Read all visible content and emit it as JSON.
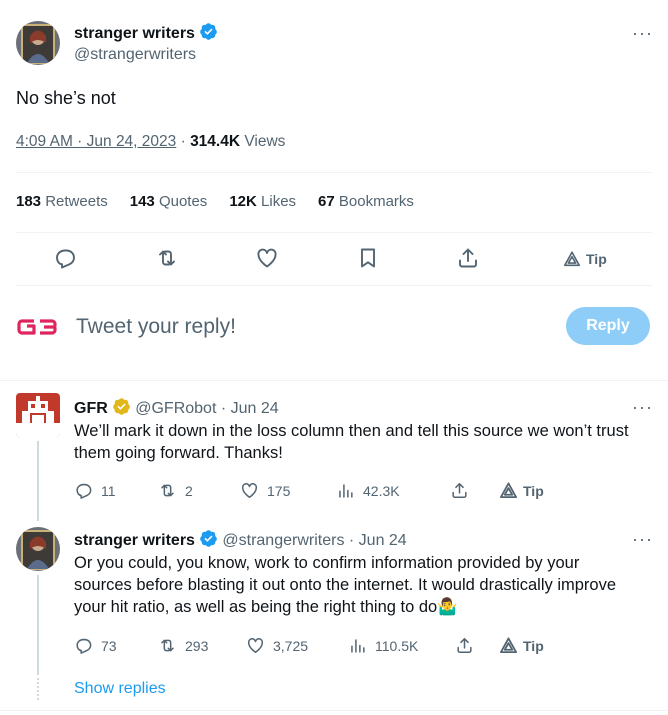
{
  "main_tweet": {
    "author_name": "stranger writers",
    "author_handle": "@strangerwriters",
    "text": "No she’s not",
    "time": "4:09 AM · Jun 24, 2023",
    "separator": " · ",
    "views_count": "314.4K",
    "views_label": "Views",
    "stats": {
      "retweets_count": "183",
      "retweets_label": "Retweets",
      "quotes_count": "143",
      "quotes_label": "Quotes",
      "likes_count": "12K",
      "likes_label": "Likes",
      "bookmarks_count": "67",
      "bookmarks_label": "Bookmarks"
    },
    "tip_label": "Tip"
  },
  "reply_box": {
    "prompt": "Tweet your reply!",
    "button_label": "Reply"
  },
  "replies": [
    {
      "author_name": "GFR",
      "author_handle": "@GFRobot",
      "date": "· Jun 24",
      "text": "We’ll mark it down in the loss column then and tell this source we won’t trust them going forward. Thanks!",
      "replies_count": "11",
      "retweets_count": "2",
      "likes_count": "175",
      "views_count": "42.3K",
      "tip_label": "Tip"
    },
    {
      "author_name": "stranger writers",
      "author_handle": "@strangerwriters",
      "date": "· Jun 24",
      "text": "Or you could, you know, work to confirm information provided by your sources before blasting it out onto the internet. It would drastically improve your hit ratio, as well as being the right thing to do🤷‍♂️",
      "replies_count": "73",
      "retweets_count": "293",
      "likes_count": "3,725",
      "views_count": "110.5K",
      "tip_label": "Tip"
    }
  ],
  "show_replies_label": "Show replies",
  "colors": {
    "accent": "#1d9bf0",
    "reply_button": "#8ecdf8",
    "secondary_text": "#536471",
    "gold_badge": "#e2b719",
    "gb_logo": "#e0245e"
  }
}
